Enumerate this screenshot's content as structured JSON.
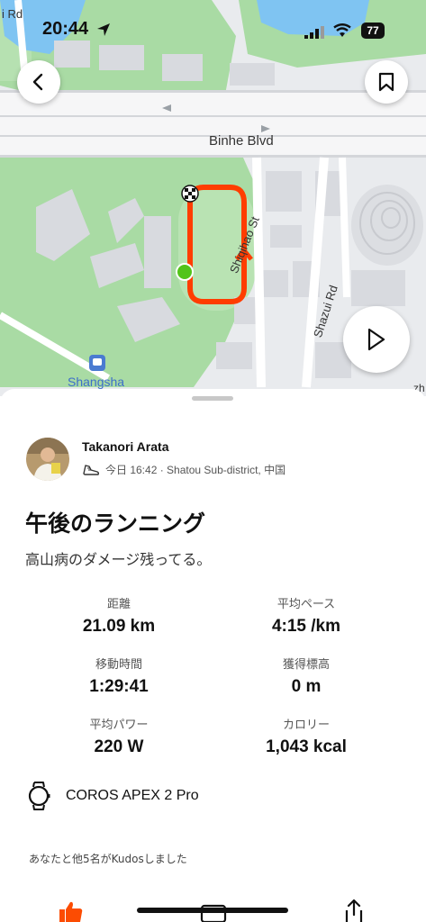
{
  "status_bar": {
    "time": "20:44",
    "battery": "77"
  },
  "map": {
    "labels": {
      "road_main": "Binhe Blvd",
      "street_1": "Shiqihao St",
      "street_2": "Shazui Rd",
      "station": "Shangsha",
      "edge_top_left": "i Rd",
      "edge_right": "zh"
    },
    "colors": {
      "route": "#ff3d00",
      "park": "#a8dca0",
      "water": "#7fc4f2",
      "start": "#52c41a"
    }
  },
  "athlete": {
    "name": "Takanori Arata",
    "meta": "今日 16:42 · Shatou Sub-district, 中国"
  },
  "activity": {
    "title": "午後のランニング",
    "description": "高山病のダメージ残ってる。"
  },
  "stats": [
    {
      "label": "距離",
      "value": "21.09 km"
    },
    {
      "label": "平均ペース",
      "value": "4:15 /km"
    },
    {
      "label": "移動時間",
      "value": "1:29:41"
    },
    {
      "label": "獲得標高",
      "value": "0 m"
    },
    {
      "label": "平均パワー",
      "value": "220 W"
    },
    {
      "label": "カロリー",
      "value": "1,043 kcal"
    }
  ],
  "device": {
    "name": "COROS APEX 2 Pro"
  },
  "kudos": {
    "text": "あなたと他5名がKudosしました"
  },
  "accent_color": "#fc4c02"
}
